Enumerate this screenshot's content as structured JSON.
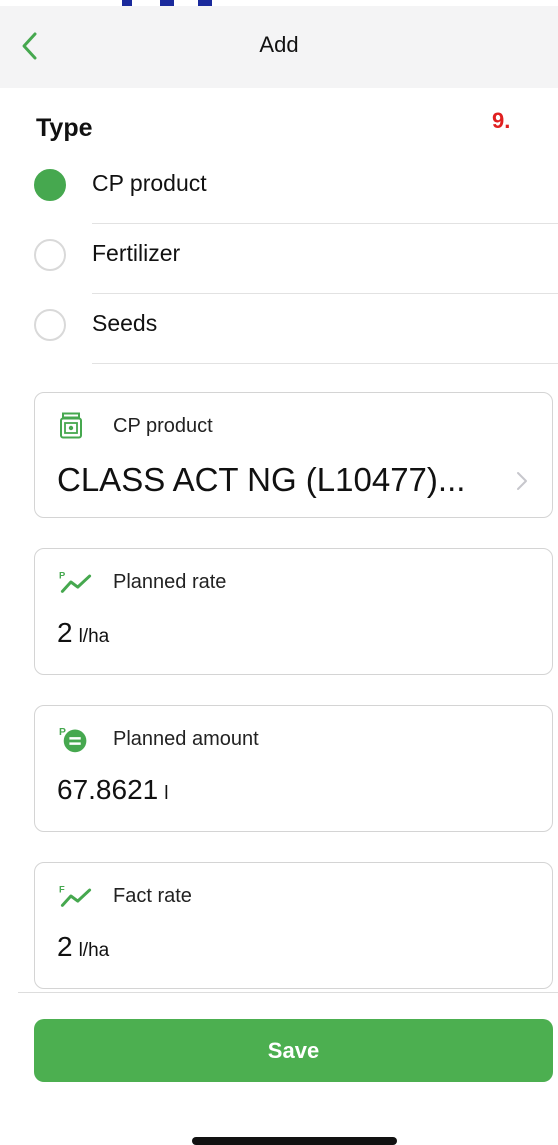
{
  "header": {
    "title": "Add",
    "back_icon": "chevron-left-icon",
    "accent_color": "#46a84f"
  },
  "annotation": {
    "step_number": "9."
  },
  "type_section": {
    "title": "Type",
    "options": [
      {
        "label": "CP product",
        "selected": true
      },
      {
        "label": "Fertilizer",
        "selected": false
      },
      {
        "label": "Seeds",
        "selected": false
      }
    ]
  },
  "fields": {
    "cp_product": {
      "icon": "product-canister-icon",
      "label": "CP product",
      "value": "CLASS ACT NG (L10477)..."
    },
    "planned_rate": {
      "icon": "planned-rate-trend-icon",
      "label": "Planned rate",
      "value": "2",
      "unit": "l/ha"
    },
    "planned_amount": {
      "icon": "planned-amount-icon",
      "label": "Planned amount",
      "value": "67.8621",
      "unit": "l"
    },
    "fact_rate": {
      "icon": "fact-rate-trend-icon",
      "label": "Fact rate",
      "value": "2",
      "unit": "l/ha"
    }
  },
  "actions": {
    "save_label": "Save",
    "save_color": "#4caf50"
  }
}
